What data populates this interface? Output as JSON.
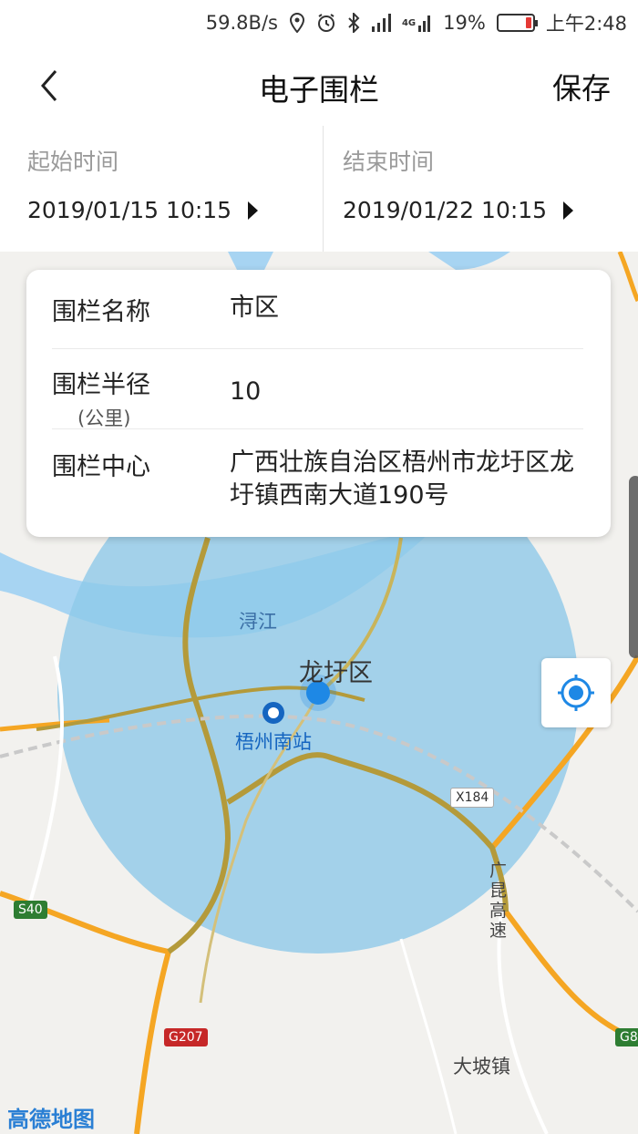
{
  "status_bar": {
    "net_speed": "59.8B/s",
    "signal_4g": "4G",
    "battery_percent": "19%",
    "battery_level": 0.19,
    "battery_color": "#e53935",
    "time": "上午2:48",
    "icons": [
      "location-icon",
      "alarm-icon",
      "bluetooth-icon",
      "signal-icon",
      "signal-4g-icon",
      "battery-icon"
    ]
  },
  "header": {
    "back_icon": "chevron-left-icon",
    "title": "电子围栏",
    "save_label": "保存"
  },
  "time_range": {
    "start_label": "起始时间",
    "start_value": "2019/01/15 10:15",
    "end_label": "结束时间",
    "end_value": "2019/01/22 10:15",
    "picker_icon": "triangle-right-icon"
  },
  "fence_card": {
    "name_label": "围栏名称",
    "name_value": "市区",
    "radius_label": "围栏半径",
    "radius_unit": "(公里)",
    "radius_value": "10",
    "center_label": "围栏中心",
    "center_value": "广西壮族自治区梧州市龙圩区龙圩镇西南大道190号"
  },
  "map": {
    "labels": {
      "river": "浔江",
      "district": "龙圩区",
      "station": "梧州南站",
      "town": "大坡镇",
      "expressway": "广昆高速",
      "road_x184": "X184",
      "road_s40": "S40",
      "road_g207": "G207",
      "road_g8": "G8",
      "provider": "高德地图"
    },
    "fence_color": "#8ec9e8",
    "river_color": "#a7d4f2",
    "highway_color": "#f5a623",
    "locate_icon": "locate-target-icon"
  }
}
